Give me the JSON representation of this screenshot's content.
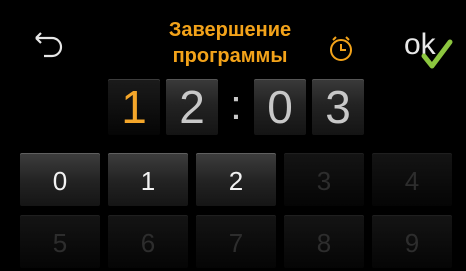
{
  "header": {
    "title_line1": "Завершение",
    "title_line2": "программы",
    "back_icon": "back-arrow-icon",
    "clock_icon": "clock-icon",
    "ok_label": "ok",
    "accent_color": "#f3a31a",
    "check_color": "#8cc63f"
  },
  "time": {
    "hours_tens": "1",
    "hours_ones": "2",
    "separator": ":",
    "minutes_tens": "0",
    "minutes_ones": "3",
    "active_digit": "hours_tens"
  },
  "keypad": {
    "keys": [
      {
        "label": "0",
        "enabled": true
      },
      {
        "label": "1",
        "enabled": true
      },
      {
        "label": "2",
        "enabled": true
      },
      {
        "label": "3",
        "enabled": false
      },
      {
        "label": "4",
        "enabled": false
      },
      {
        "label": "5",
        "enabled": false
      },
      {
        "label": "6",
        "enabled": false
      },
      {
        "label": "7",
        "enabled": false
      },
      {
        "label": "8",
        "enabled": false
      },
      {
        "label": "9",
        "enabled": false
      }
    ]
  }
}
